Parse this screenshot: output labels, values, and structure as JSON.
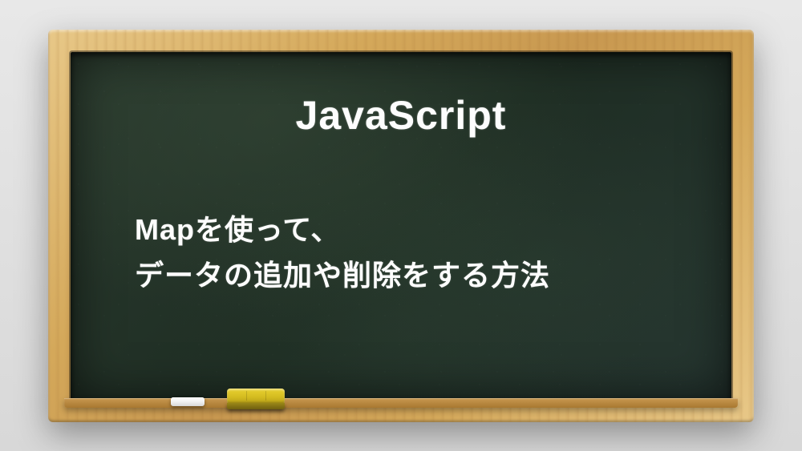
{
  "title": "JavaScript",
  "subtitle_line1": "Mapを使って、",
  "subtitle_line2": "データの追加や削除をする方法"
}
